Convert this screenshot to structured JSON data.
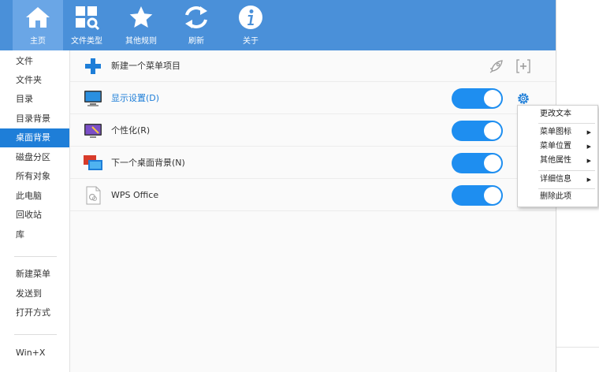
{
  "toolbar": {
    "buttons": [
      {
        "label": "主页",
        "icon": "home-icon",
        "active": true
      },
      {
        "label": "文件类型",
        "icon": "file-types-icon"
      },
      {
        "label": "其他规则",
        "icon": "star-icon"
      },
      {
        "label": "刷新",
        "icon": "refresh-icon"
      },
      {
        "label": "关于",
        "icon": "info-icon"
      }
    ]
  },
  "sidebar": {
    "items": [
      "文件",
      "文件夹",
      "目录",
      "目录背景",
      "桌面背景",
      "磁盘分区",
      "所有对象",
      "此电脑",
      "回收站",
      "库"
    ],
    "selected": "桌面背景",
    "items2": [
      "新建菜单",
      "发送到",
      "打开方式"
    ],
    "items3": [
      "Win+X"
    ]
  },
  "content": {
    "new_item_label": "新建一个菜单项目",
    "rows": [
      {
        "label": "显示设置(D)",
        "icon": "monitor-icon",
        "enabled": true
      },
      {
        "label": "个性化(R)",
        "icon": "personalize-icon",
        "enabled": true
      },
      {
        "label": "下一个桌面背景(N)",
        "icon": "next-background-icon",
        "enabled": true
      },
      {
        "label": "WPS Office",
        "icon": "wps-icon",
        "enabled": true
      }
    ]
  },
  "context_menu": {
    "items": [
      {
        "label": "更改文本"
      },
      {
        "label": "菜单图标",
        "submenu": true
      },
      {
        "label": "菜单位置",
        "submenu": true
      },
      {
        "label": "其他属性",
        "submenu": true
      },
      {
        "label": "详细信息",
        "submenu": true
      },
      {
        "label": "删除此项"
      }
    ]
  },
  "colors": {
    "toolbar": "#4a90d9",
    "accent": "#1e7ed8",
    "toggle": "#1e8ef0"
  }
}
